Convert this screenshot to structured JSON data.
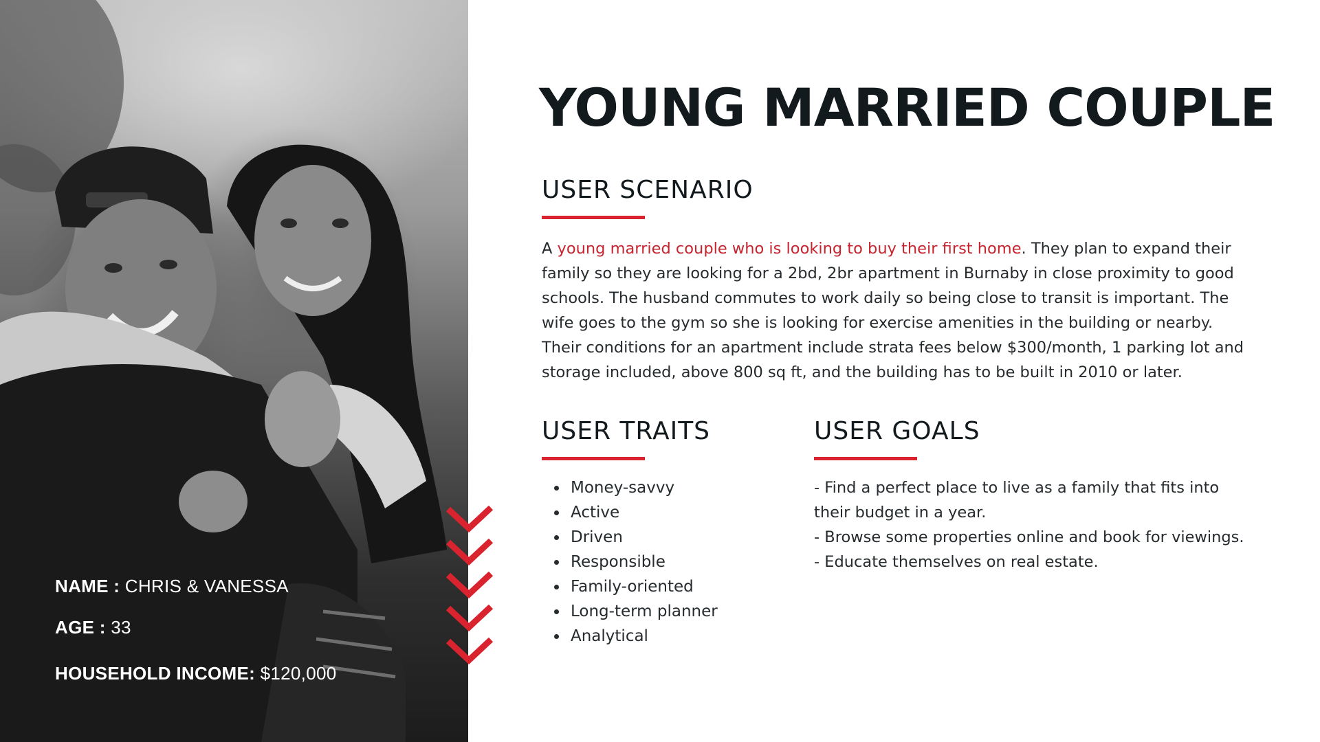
{
  "persona": {
    "title": "YOUNG MARRIED COUPLE",
    "name_label": "NAME :",
    "name_value": "CHRIS & VANESSA",
    "age_label": "AGE :",
    "age_value": "33",
    "income_label": "HOUSEHOLD INCOME:",
    "income_value": "$120,000"
  },
  "scenario": {
    "heading": "USER SCENARIO",
    "lead": "A ",
    "highlight": "young married couple who is looking to buy their first home",
    "body": ". They plan to expand their family so they are looking for a 2bd, 2br apartment in Burnaby in close proximity to good schools. The husband commutes to work daily so being close to transit is important. The wife goes to the gym so she is looking for exercise amenities in the building or nearby. Their conditions for an apartment include strata fees below $300/month, 1 parking lot and storage included, above 800 sq ft, and the building has to be built in 2010 or later."
  },
  "traits": {
    "heading": "USER TRAITS",
    "items": [
      "Money-savvy",
      "Active",
      "Driven",
      "Responsible",
      "Family-oriented",
      "Long-term planner",
      "Analytical"
    ]
  },
  "goals": {
    "heading": "USER GOALS",
    "items": [
      "- Find a perfect place to live as a family that fits into their budget in a year.",
      "- Browse some properties online and book for viewings.",
      "- Educate themselves on real estate."
    ]
  },
  "colors": {
    "accent": "#d9232e",
    "highlight_text": "#c8242f",
    "heading": "#131a1e"
  },
  "icons": [
    "photo-couple",
    "chevron-down-icon"
  ]
}
